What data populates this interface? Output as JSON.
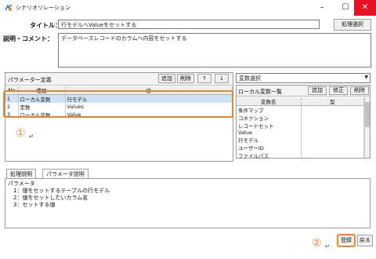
{
  "window": {
    "title": "シナリオリレーション",
    "minimize": "–",
    "maximize": "☐",
    "close": "✕"
  },
  "header": {
    "title_label": "タイトル：",
    "title_value": "行モデルへValueをセットする",
    "select_button": "処理選択",
    "desc_label": "説明・コメント：",
    "desc_value": "データベースレコードのカラムへ内容をセットする"
  },
  "params": {
    "heading": "パラメーター定義",
    "add": "追加",
    "delete": "削除",
    "up": "↑",
    "down": "↓",
    "columns": [
      "No",
      "種類",
      "値"
    ],
    "rows": [
      [
        "1",
        "ローカル変数",
        "行モデル"
      ],
      [
        "2",
        "定数",
        "Values"
      ],
      [
        "3",
        "ローカル変数",
        "Value"
      ]
    ]
  },
  "vars": {
    "combo": "変数選択",
    "combo_arrow": "▼",
    "heading": "ローカル変数一覧",
    "add": "追加",
    "edit": "修正",
    "delete": "削除",
    "columns": [
      "変数名",
      "型"
    ],
    "rows": [
      "条件マップ",
      "コネクション",
      "レコードセット",
      "Value",
      "行モデル",
      "ユーザーID",
      "ファイルパス"
    ]
  },
  "tabs": [
    "処理説明",
    "パラメータ説明"
  ],
  "help_text": [
    "パラメータ",
    "　1：値をセットするテーブルの行モデル",
    "　2：値をセットしたいカラム名",
    "　3：セットする値"
  ],
  "markers": {
    "one": "①",
    "one_suffix": "↵",
    "two": "②",
    "two_suffix": "↵"
  },
  "footer": {
    "ok": "登録",
    "back": "戻る"
  }
}
